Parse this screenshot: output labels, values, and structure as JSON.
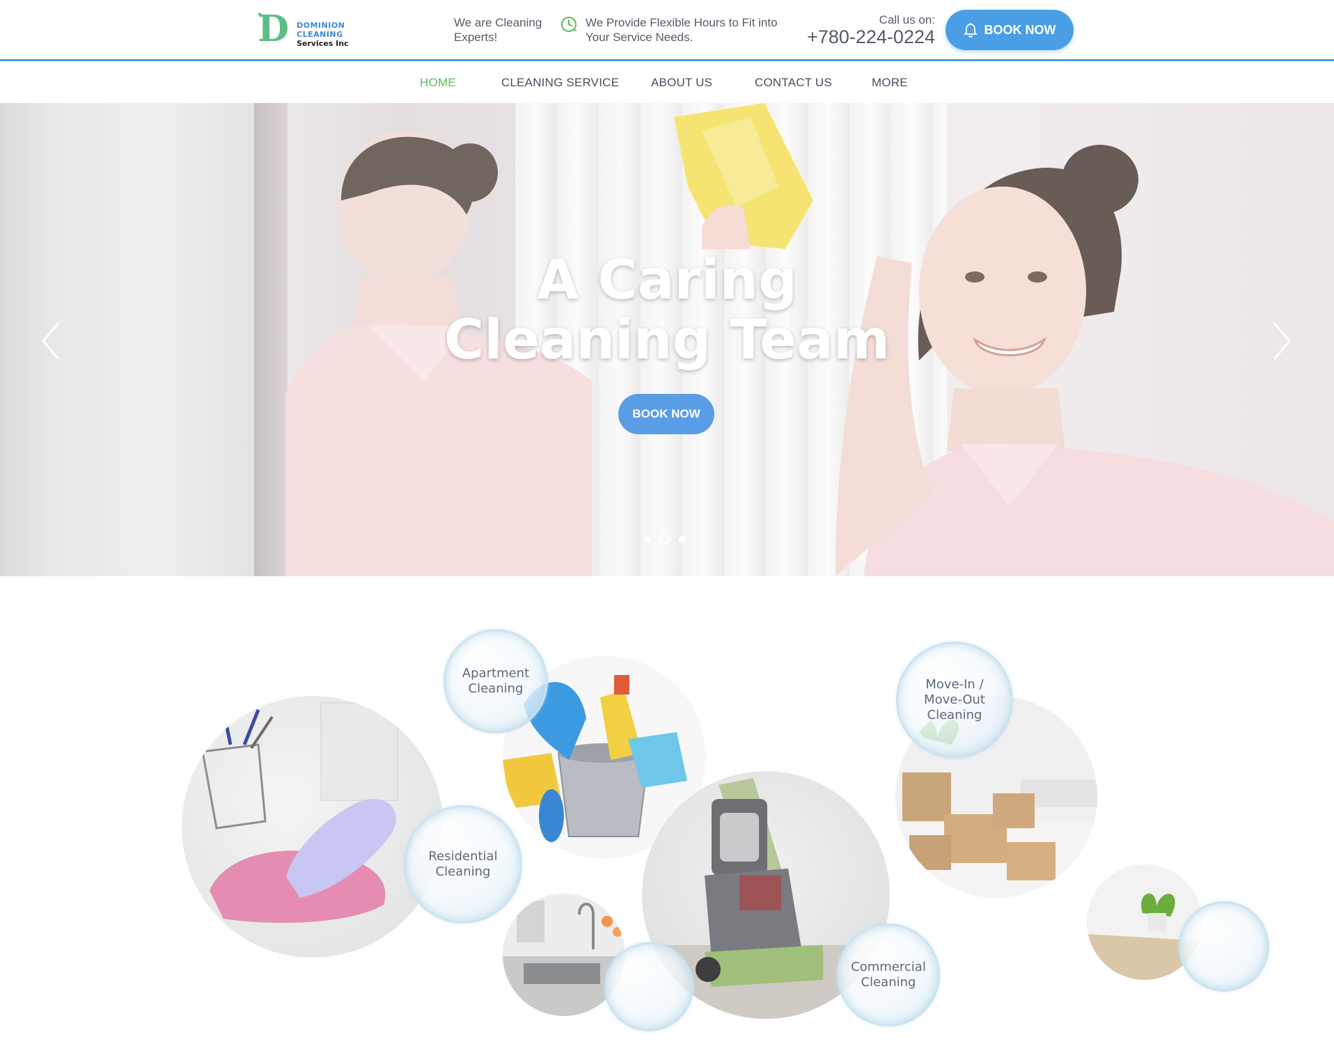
{
  "brand": {
    "logo_line1": "DOMINION",
    "logo_line2": "CLEANING",
    "logo_line3": "Services Inc",
    "logo_letter": "D",
    "primary_color": "#4a9ee6",
    "accent_green": "#5cb85c"
  },
  "header": {
    "tagline_1": "We are Cleaning Experts!",
    "tagline_2": "We Provide Flexible Hours to Fit into Your Service Needs.",
    "tagline_2_icon": "clock-icon",
    "call_label": "Call us on:",
    "phone": "+780-224-0224",
    "book_button": "BOOK NOW",
    "book_icon": "bell-icon"
  },
  "nav": {
    "items": [
      {
        "label": "HOME",
        "active": true
      },
      {
        "label": "CLEANING SERVICE",
        "active": false
      },
      {
        "label": "ABOUT US",
        "active": false
      },
      {
        "label": "CONTACT US",
        "active": false
      },
      {
        "label": "MORE",
        "active": false
      }
    ]
  },
  "hero": {
    "title_line1": "A Caring",
    "title_line2": "Cleaning Team",
    "book_button": "BOOK NOW",
    "slides_total": 3,
    "current_slide": 2,
    "prev_icon": "chevron-left-icon",
    "next_icon": "chevron-right-icon"
  },
  "services": {
    "items": [
      {
        "label": "Apartment Cleaning"
      },
      {
        "label": "Residential Cleaning"
      },
      {
        "label": "Move-In / Move-Out Cleaning"
      },
      {
        "label": "Commercial Cleaning"
      }
    ]
  }
}
